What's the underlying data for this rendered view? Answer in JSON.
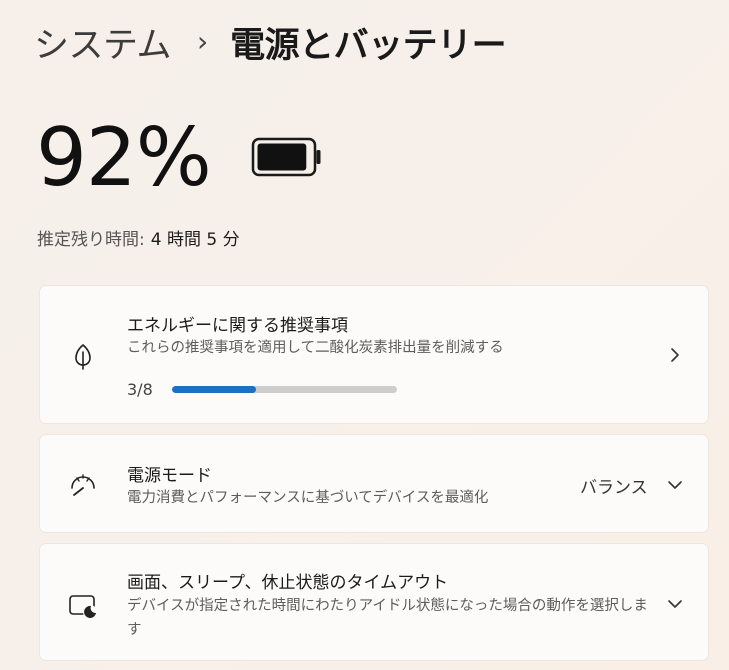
{
  "breadcrumb": {
    "parent": "システム",
    "separator": "›",
    "current": "電源とバッテリー"
  },
  "battery": {
    "percent_label": "92%",
    "level": 0.92,
    "estimate_label": "推定残り時間:",
    "estimate_value": "4 時間 5 分"
  },
  "energy_card": {
    "icon": "leaf-icon",
    "title": "エネルギーに関する推奨事項",
    "description": "これらの推奨事項を適用して二酸化炭素排出量を削減する",
    "progress_text": "3/8",
    "progress_value": 3,
    "progress_max": 8
  },
  "power_mode_card": {
    "icon": "gauge-icon",
    "title": "電源モード",
    "description": "電力消費とパフォーマンスに基づいてデバイスを最適化",
    "selected_value": "バランス"
  },
  "sleep_card": {
    "icon": "screen-sleep-icon",
    "title": "画面、スリープ、休止状態のタイムアウト",
    "description": "デバイスが指定された時間にわたりアイドル状態になった場合の動作を選択します"
  },
  "colors": {
    "accent": "#1d6fc1",
    "track": "#cdcdcd"
  }
}
